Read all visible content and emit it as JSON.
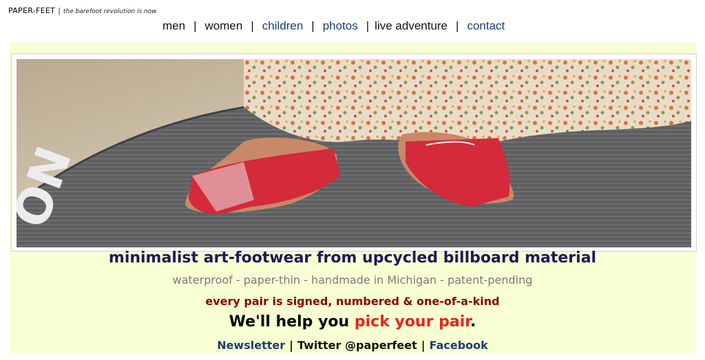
{
  "brand": {
    "name": "PAPER-FEET",
    "separator": "|",
    "tagline": "the barefoot revolution is now"
  },
  "nav": {
    "items": [
      {
        "label": "men"
      },
      {
        "label": "women"
      },
      {
        "label": "children"
      },
      {
        "label": "photos"
      },
      {
        "label": "live adventure"
      },
      {
        "label": "contact"
      }
    ],
    "separator": "|"
  },
  "hero": {
    "image_alt": "feet wearing red billboard-material sandals standing on a surfboard on the sand",
    "board_lettering": "ON"
  },
  "content": {
    "headline": "minimalist art-footwear from upcycled billboard material",
    "subline": "waterproof - paper-thin - handmade in Michigan - patent-pending",
    "signed_line": "every pair is signed, numbered & one-of-a-kind",
    "help_prefix": "We'll help you ",
    "help_link": "pick your pair",
    "help_suffix": "."
  },
  "footer_links": {
    "newsletter": "Newsletter",
    "separator": "|",
    "twitter": "Twitter @paperfeet",
    "facebook": "Facebook"
  },
  "colors": {
    "panel_bg": "#f8ffd2",
    "headline": "#1c1a5e",
    "signed": "#8a0000",
    "link_blue": "#1a3e6e",
    "cta_red": "#e8231e"
  }
}
